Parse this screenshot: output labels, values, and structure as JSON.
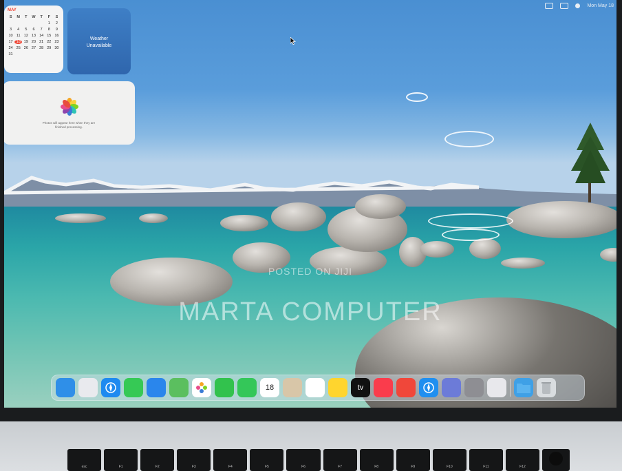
{
  "menubar": {
    "datetime": "Mon May 18"
  },
  "calendar_widget": {
    "month": "MAY",
    "weekdays": [
      "S",
      "M",
      "T",
      "W",
      "T",
      "F",
      "S"
    ],
    "days": [
      "",
      "",
      "",
      "",
      "",
      "1",
      "2",
      "3",
      "4",
      "5",
      "6",
      "7",
      "8",
      "9",
      "10",
      "11",
      "12",
      "13",
      "14",
      "15",
      "16",
      "17",
      "18",
      "19",
      "20",
      "21",
      "22",
      "23",
      "24",
      "25",
      "26",
      "27",
      "28",
      "29",
      "30",
      "31",
      "",
      "",
      "",
      "",
      "",
      ""
    ],
    "today": "18"
  },
  "weather_widget": {
    "line1": "Weather",
    "line2": "Unavailable"
  },
  "photos_widget": {
    "message_line1": "Photos will appear here when they are",
    "message_line2": "finished processing."
  },
  "watermark": {
    "line1": "POSTED ON JIJI",
    "line2": "MARTA COMPUTER"
  },
  "dock": {
    "calendar_date": "18",
    "apple_tv_label": "tv",
    "apps": [
      {
        "name": "finder-icon",
        "color": "#2f8fe8"
      },
      {
        "name": "launchpad-icon",
        "color": "#e9eaee"
      },
      {
        "name": "safari-icon",
        "color": "#1e8af0"
      },
      {
        "name": "messages-icon",
        "color": "#36c955"
      },
      {
        "name": "mail-icon",
        "color": "#2a86ec"
      },
      {
        "name": "maps-icon",
        "color": "#5bbf5f"
      },
      {
        "name": "photos-icon",
        "color": "#ffffff"
      },
      {
        "name": "facetime-icon",
        "color": "#32c24d"
      },
      {
        "name": "phone-icon",
        "color": "#34c759"
      },
      {
        "name": "calendar-icon",
        "color": "#ffffff"
      },
      {
        "name": "contacts-icon",
        "color": "#d8c6a8"
      },
      {
        "name": "reminders-icon",
        "color": "#ffffff"
      },
      {
        "name": "notes-icon",
        "color": "#ffd52e"
      },
      {
        "name": "apple-tv-icon",
        "color": "#111111"
      },
      {
        "name": "music-icon",
        "color": "#fa3c4c"
      },
      {
        "name": "rocket-icon",
        "color": "#f0473a"
      },
      {
        "name": "app-store-icon",
        "color": "#1f8ff0"
      },
      {
        "name": "iphone-mirroring-icon",
        "color": "#6c7bd8"
      },
      {
        "name": "system-settings-icon",
        "color": "#8e8e93"
      },
      {
        "name": "preview-icon",
        "color": "#e8e8ec"
      },
      {
        "name": "downloads-folder-icon",
        "color": "#3fa0e6"
      },
      {
        "name": "trash-icon",
        "color": "#d9dde0"
      }
    ]
  },
  "keyboard": {
    "fn_keys": [
      "esc",
      "F1",
      "F2",
      "F3",
      "F4",
      "F5",
      "F6",
      "F7",
      "F8",
      "F9",
      "F10",
      "F11",
      "F12"
    ]
  }
}
